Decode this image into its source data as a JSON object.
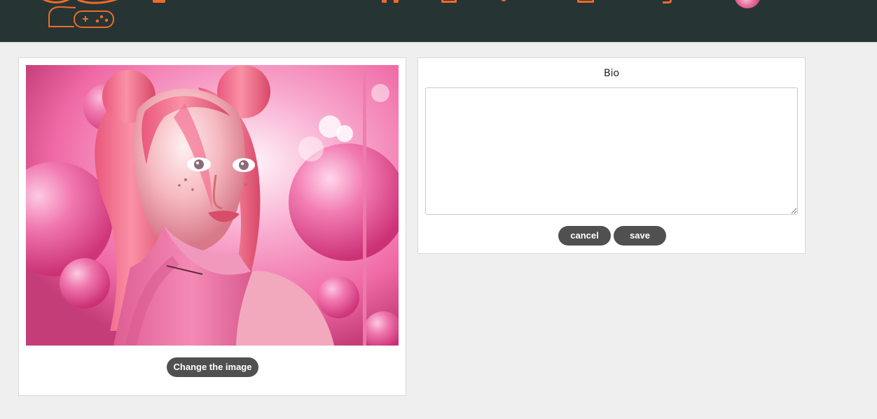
{
  "header": {
    "logo_icon": "gaming-logo-icon",
    "nav_icons": [
      "menu-icon",
      "grid-icon",
      "document-icon",
      "location-icon",
      "mail-icon",
      "bookmark-icon"
    ],
    "avatar_label": "user-avatar",
    "accent_color": "#ef6a2c",
    "background_color": "#263533"
  },
  "profile_image": {
    "alt": "pink-haired character portrait",
    "change_button_label": "Change the image"
  },
  "bio": {
    "title": "Bio",
    "textarea_value": "",
    "textarea_placeholder": "",
    "cancel_label": "cancel",
    "save_label": "save"
  },
  "colors": {
    "page_background": "#efefef",
    "button_background": "#505050",
    "button_text": "#ffffff"
  }
}
